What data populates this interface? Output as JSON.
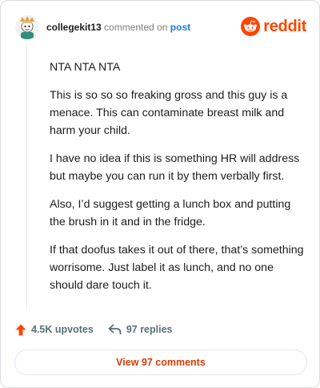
{
  "header": {
    "username": "collegekit13",
    "action": "commented on",
    "post_link": "post",
    "brand": "reddit"
  },
  "comment": {
    "paragraphs": [
      "NTA NTA NTA",
      "This is so so so freaking gross and this guy is a menace. This can contaminate breast milk and harm your child.",
      "I have no idea if this is something HR will address but maybe you can run it by them verbally first.",
      "Also, I’d suggest getting a lunch box and putting the brush in it and in the fridge.",
      "If that doofus takes it out of there, that’s something worrisome. Just label it as lunch, and no one should dare touch it."
    ]
  },
  "footer": {
    "upvotes": "4.5K upvotes",
    "replies": "97 replies",
    "upvote_icon": "upvote-arrow-icon",
    "reply_icon": "reply-arrow-icon"
  },
  "view_comments_label": "View 97 comments",
  "colors": {
    "brand": "#ff4500",
    "link": "#1c7ad8",
    "upvote": "#ff4500",
    "view_button_text": "#d93a00",
    "muted": "#576f76"
  }
}
